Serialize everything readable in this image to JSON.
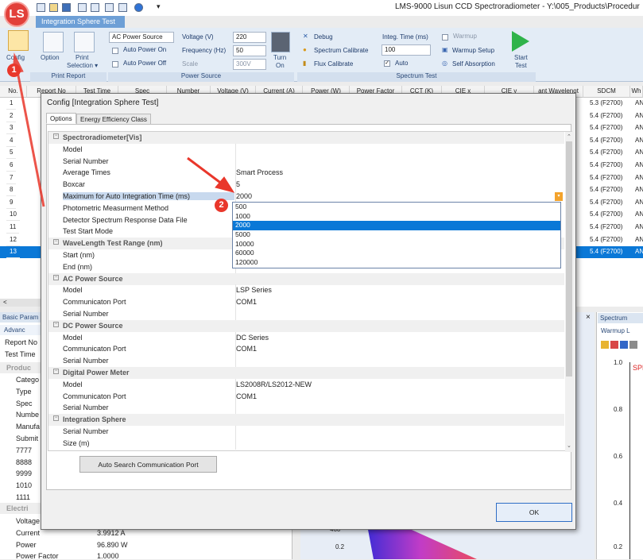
{
  "app": {
    "title": "LMS-9000 Lisun CCD Spectroradiometer - Y:\\005_Products\\Procedur",
    "logo_text": "LS",
    "active_tab": "Integration Sphere Test"
  },
  "ribbon": {
    "config_label": "Config",
    "option_label": "Option",
    "print_label": "Print",
    "print_selection_label": "Selection ▾",
    "print_report_group": "Print Report",
    "ac_source_select": "AC Power Source",
    "auto_power_on": "Auto Power On",
    "auto_power_off": "Auto Power Off",
    "voltage_label": "Voltage (V)",
    "voltage_value": "220",
    "frequency_label": "Frequency (Hz)",
    "frequency_value": "50",
    "scale_label": "Scale",
    "scale_value": "300V",
    "turn_on_line1": "Turn",
    "turn_on_line2": "On",
    "power_source_group": "Power Source",
    "debug_label": "Debug",
    "spectrum_calibrate": "Spectrum Calibrate",
    "flux_calibrate": "Flux Calibrate",
    "integ_time_label": "Integ. Time (ms)",
    "integ_time_value": "100",
    "auto_label": "Auto",
    "warmup_label": "Warmup",
    "warmup_setup": "Warmup Setup",
    "self_absorption": "Self Absorption",
    "start_line1": "Start",
    "start_line2": "Test",
    "spectrum_test_group": "Spectrum Test"
  },
  "grid": {
    "headers": [
      "No.",
      "Report No",
      "Test Time",
      "Spec",
      "Number",
      "Voltage (V)",
      "Current (A)",
      "Power (W)",
      "Power Factor",
      "CCT (K)",
      "CIE x",
      "CIE y",
      "ant Wavelengt",
      "SDCM",
      "Wh"
    ],
    "rows": [
      {
        "no": "1",
        "sdcm": "5.3 (F2700)",
        "wh": "AN"
      },
      {
        "no": "2",
        "sdcm": "5.4 (F2700)",
        "wh": "AN"
      },
      {
        "no": "3",
        "sdcm": "5.4 (F2700)",
        "wh": "AN"
      },
      {
        "no": "4",
        "sdcm": "5.4 (F2700)",
        "wh": "AN"
      },
      {
        "no": "5",
        "sdcm": "5.4 (F2700)",
        "wh": "AN"
      },
      {
        "no": "6",
        "sdcm": "5.4 (F2700)",
        "wh": "AN"
      },
      {
        "no": "7",
        "sdcm": "5.4 (F2700)",
        "wh": "AN"
      },
      {
        "no": "8",
        "sdcm": "5.4 (F2700)",
        "wh": "AN"
      },
      {
        "no": "9",
        "sdcm": "5.4 (F2700)",
        "wh": "AN"
      },
      {
        "no": "10",
        "sdcm": "5.4 (F2700)",
        "wh": "AN"
      },
      {
        "no": "11",
        "sdcm": "5.4 (F2700)",
        "wh": "AN"
      },
      {
        "no": "12",
        "sdcm": "5.4 (F2700)",
        "wh": "AN"
      },
      {
        "no": "13",
        "sdcm": "5.4 (F2700)",
        "wh": "AN"
      }
    ],
    "scroll_left": "<"
  },
  "left_panel": {
    "title": "Basic Param",
    "advanced": "Advanc",
    "report_no": "Report No",
    "test_time": "Test Time",
    "product_group": "Produc",
    "items": [
      "Catego",
      "Type",
      "Spec",
      "Numbe",
      "Manufa",
      "Submit",
      "7777",
      "8888",
      "9999",
      "1010",
      "1111"
    ],
    "electric_group": "Electri",
    "elec": [
      {
        "name": "Voltage",
        "value": ""
      },
      {
        "name": "Current",
        "value": "3.9912 A"
      },
      {
        "name": "Power",
        "value": "96.890 W"
      },
      {
        "name": "Power Factor",
        "value": "1.0000"
      }
    ]
  },
  "right_panel": {
    "title": "Spectrum",
    "warmup": "Warmup L",
    "spd": "SPD",
    "y_ticks": [
      "1.0",
      "0.8",
      "0.6",
      "0.4",
      "0.2"
    ],
    "x_close": "×"
  },
  "bg_chart": {
    "y_ticks": [
      "460",
      "0.2"
    ]
  },
  "dialog": {
    "title": "Config [Integration Sphere Test]",
    "tabs": [
      "Options",
      "Energy Efficiency Class"
    ],
    "collapse_glyph": "−",
    "rows": [
      {
        "type": "cat",
        "name": "Spectroradiometer[Vis]"
      },
      {
        "type": "prop",
        "name": "Model",
        "value": ""
      },
      {
        "type": "prop",
        "name": "Serial Number",
        "value": ""
      },
      {
        "type": "prop",
        "name": "Average Times",
        "value": "Smart Process"
      },
      {
        "type": "prop",
        "name": "Boxcar",
        "value": "5"
      },
      {
        "type": "prop",
        "name": "Maximum for Auto Integration Time (ms)",
        "value": "2000",
        "selected": true
      },
      {
        "type": "prop",
        "name": "Photometric Measurment Method",
        "value": ""
      },
      {
        "type": "prop",
        "name": "Detector Spectrum Response Data File",
        "value": ""
      },
      {
        "type": "prop",
        "name": "Test Start Mode",
        "value": ""
      },
      {
        "type": "cat",
        "name": "WaveLength Test Range (nm)"
      },
      {
        "type": "prop",
        "name": "Start (nm)",
        "value": ""
      },
      {
        "type": "prop",
        "name": "End (nm)",
        "value": ""
      },
      {
        "type": "cat",
        "name": "AC Power Source"
      },
      {
        "type": "prop",
        "name": "Model",
        "value": "LSP Series"
      },
      {
        "type": "prop",
        "name": "Communicaton Port",
        "value": "COM1"
      },
      {
        "type": "prop",
        "name": "Serial Number",
        "value": ""
      },
      {
        "type": "cat",
        "name": "DC Power Source"
      },
      {
        "type": "prop",
        "name": "Model",
        "value": "DC Series"
      },
      {
        "type": "prop",
        "name": "Communicaton Port",
        "value": "COM1"
      },
      {
        "type": "prop",
        "name": "Serial Number",
        "value": ""
      },
      {
        "type": "cat",
        "name": "Digital Power Meter"
      },
      {
        "type": "prop",
        "name": "Model",
        "value": "LS2008R/LS2012-NEW"
      },
      {
        "type": "prop",
        "name": "Communicaton Port",
        "value": "COM1"
      },
      {
        "type": "prop",
        "name": "Serial Number",
        "value": ""
      },
      {
        "type": "cat",
        "name": "Integration Sphere"
      },
      {
        "type": "prop",
        "name": "Serial Number",
        "value": ""
      },
      {
        "type": "prop",
        "name": "Size (m)",
        "value": ""
      }
    ],
    "dropdown_options": [
      "500",
      "1000",
      "2000",
      "5000",
      "10000",
      "60000",
      "120000"
    ],
    "dropdown_selected": "2000",
    "auto_search_button": "Auto Search Communication Port",
    "ok_button": "OK"
  },
  "annotations": {
    "badge1": "1",
    "badge2": "2"
  },
  "colors": {
    "accent": "#0a78d7",
    "annotation_red": "#e9372b",
    "row_selected": "#0a78d7",
    "tab_blue": "#6d9fd6"
  }
}
